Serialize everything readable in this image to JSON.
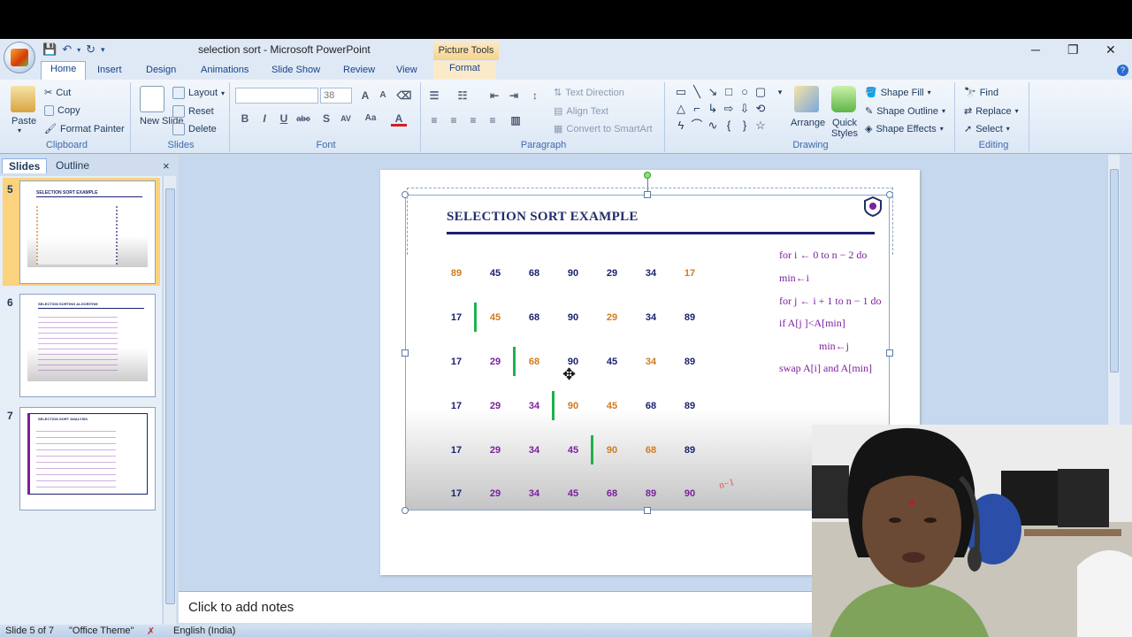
{
  "window": {
    "title": "selection sort - Microsoft PowerPoint",
    "contextual_tools": "Picture Tools",
    "controls": {
      "minimize": "─",
      "restore": "❐",
      "close": "✕"
    }
  },
  "tabs": [
    "Home",
    "Insert",
    "Design",
    "Animations",
    "Slide Show",
    "Review",
    "View",
    "Format"
  ],
  "ribbon": {
    "clipboard": {
      "label": "Clipboard",
      "paste": "Paste",
      "cut": "Cut",
      "copy": "Copy",
      "format_painter": "Format Painter"
    },
    "slides": {
      "label": "Slides",
      "new_slide": "New Slide",
      "layout": "Layout",
      "reset": "Reset",
      "delete": "Delete"
    },
    "font": {
      "label": "Font",
      "font_size": "38",
      "bold": "B",
      "italic": "I",
      "underline": "U",
      "strike": "abc",
      "shadow": "S",
      "spacing": "AV",
      "case": "Aa",
      "color": "A",
      "grow": "A",
      "shrink": "A"
    },
    "paragraph": {
      "label": "Paragraph",
      "text_direction": "Text Direction",
      "align_text": "Align Text",
      "convert_smartart": "Convert to SmartArt"
    },
    "drawing": {
      "label": "Drawing",
      "arrange": "Arrange",
      "quick_styles": "Quick Styles",
      "shape_fill": "Shape Fill",
      "shape_outline": "Shape Outline",
      "shape_effects": "Shape Effects"
    },
    "editing": {
      "label": "Editing",
      "find": "Find",
      "replace": "Replace",
      "select": "Select"
    }
  },
  "left_pane": {
    "tabs": [
      "Slides",
      "Outline"
    ],
    "close": "×",
    "slides": [
      {
        "number": "5",
        "title": "SELECTION SORT EXAMPLE"
      },
      {
        "number": "6",
        "title": "SELECTION SORTING ALGORITHM"
      },
      {
        "number": "7",
        "title": "SELECTION SORT ANALYSIS"
      }
    ]
  },
  "slide": {
    "title": "SELECTION SORT EXAMPLE",
    "rows": [
      {
        "values": [
          "89",
          "45",
          "68",
          "90",
          "29",
          "34",
          "17"
        ],
        "colors": [
          "#d17a1f",
          "#1c2270",
          "#1c2270",
          "#1c2270",
          "#1c2270",
          "#1c2270",
          "#d17a1f"
        ],
        "bar_after": -1
      },
      {
        "values": [
          "17",
          "45",
          "68",
          "90",
          "29",
          "34",
          "89"
        ],
        "colors": [
          "#1c2270",
          "#d17a1f",
          "#1c2270",
          "#1c2270",
          "#d17a1f",
          "#1c2270",
          "#1c2270"
        ],
        "bar_after": 0
      },
      {
        "values": [
          "17",
          "29",
          "68",
          "90",
          "45",
          "34",
          "89"
        ],
        "colors": [
          "#1c2270",
          "#7c1fa0",
          "#d17a1f",
          "#1c2270",
          "#1c2270",
          "#d17a1f",
          "#1c2270"
        ],
        "bar_after": 1
      },
      {
        "values": [
          "17",
          "29",
          "34",
          "90",
          "45",
          "68",
          "89"
        ],
        "colors": [
          "#1c2270",
          "#7c1fa0",
          "#7c1fa0",
          "#d17a1f",
          "#d17a1f",
          "#1c2270",
          "#1c2270"
        ],
        "bar_after": 2
      },
      {
        "values": [
          "17",
          "29",
          "34",
          "45",
          "90",
          "68",
          "89"
        ],
        "colors": [
          "#1c2270",
          "#7c1fa0",
          "#7c1fa0",
          "#7c1fa0",
          "#d17a1f",
          "#d17a1f",
          "#1c2270"
        ],
        "bar_after": 3
      },
      {
        "values": [
          "17",
          "29",
          "34",
          "45",
          "68",
          "89",
          "90"
        ],
        "colors": [
          "#1c2270",
          "#7c1fa0",
          "#7c1fa0",
          "#7c1fa0",
          "#7c1fa0",
          "#7c1fa0",
          "#7c1fa0"
        ],
        "bar_after": -1
      }
    ],
    "algorithm": [
      "for i ← 0 to n − 2 do",
      "min←i",
      "for j ← i + 1 to n − 1 do",
      "if A[j ]<A[min]",
      "min←j",
      "swap A[i] and A[min]"
    ],
    "annotation": "n−1"
  },
  "notes": {
    "placeholder": "Click to add notes"
  },
  "status": {
    "slide": "Slide 5 of 7",
    "theme": "\"Office Theme\"",
    "language": "English (India)"
  },
  "colors": {
    "accent": "#15428b",
    "ribbon_bg": "#dbe7f5",
    "selected_thumb": "#fbd27d",
    "bar": "#1fb14c"
  }
}
